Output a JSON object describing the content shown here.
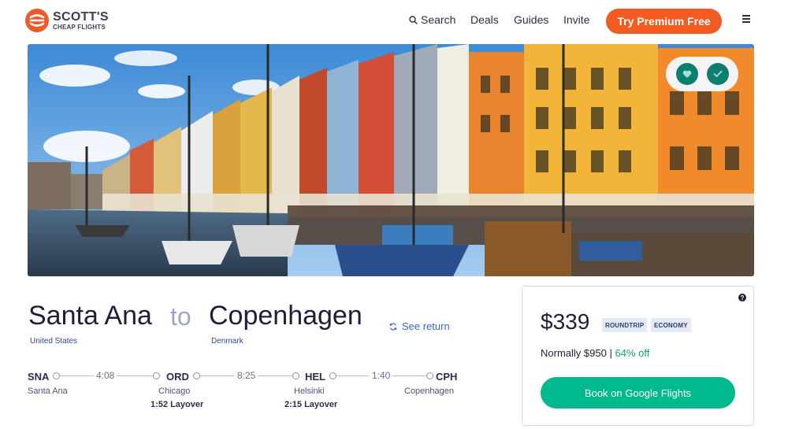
{
  "brand": {
    "name": "SCOTT'S",
    "tagline": "CHEAP FLIGHTS",
    "color": "#f05a28"
  },
  "nav": {
    "search": "Search",
    "deals": "Deals",
    "guides": "Guides",
    "invite": "Invite",
    "premium": "Try Premium Free",
    "menu_icon": "hamburger-icon"
  },
  "hero": {
    "image": "Nyhavn harbor, Copenhagen — colorful townhouses and wooden boats",
    "actions": [
      "heart-icon",
      "check-icon"
    ]
  },
  "route": {
    "origin": "Santa Ana",
    "origin_country": "United States",
    "connector": "to",
    "destination": "Copenhagen",
    "destination_country": "Denmark",
    "see_return": "See return"
  },
  "itinerary": {
    "stops": [
      {
        "code": "SNA",
        "city": "Santa Ana"
      },
      {
        "code": "ORD",
        "city": "Chicago",
        "layover": "1:52 Layover"
      },
      {
        "code": "HEL",
        "city": "Helsinki",
        "layover": "2:15 Layover"
      },
      {
        "code": "CPH",
        "city": "Copenhagen"
      }
    ],
    "durations": [
      "4:08",
      "8:25",
      "1:40"
    ]
  },
  "fare": {
    "price": "$339",
    "badges": [
      "ROUNDTRIP",
      "ECONOMY"
    ],
    "normally_label": "Normally $950",
    "separator": "|",
    "discount": "64% off",
    "cta": "Book on Google Flights",
    "help": "?",
    "accent": "#00b98c"
  }
}
